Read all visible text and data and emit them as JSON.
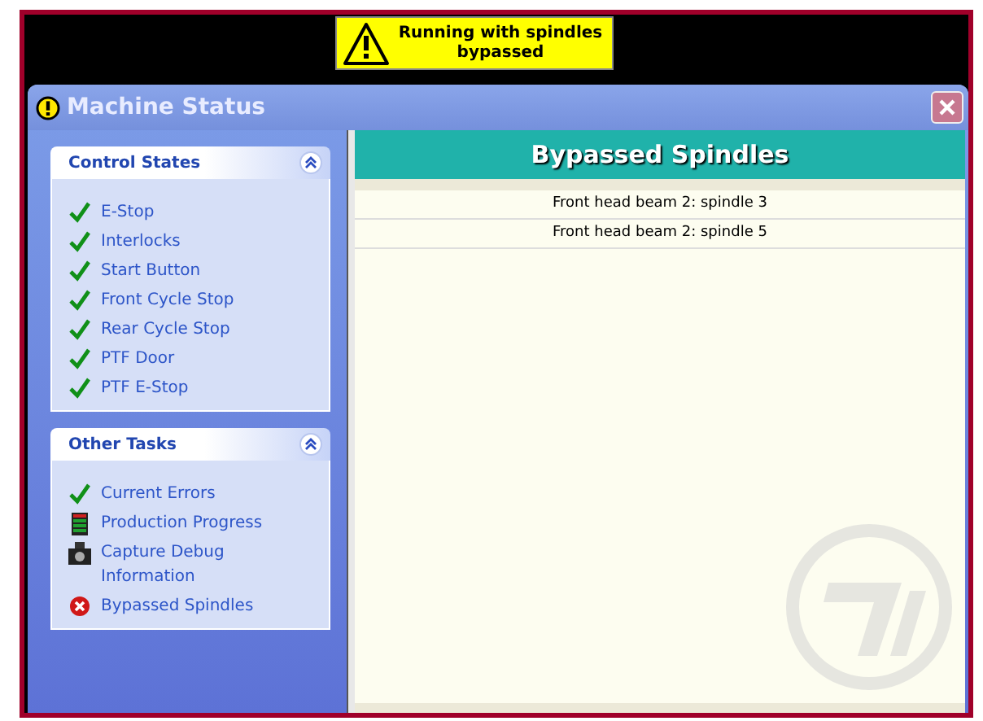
{
  "banner": {
    "text": "Running with spindles bypassed"
  },
  "window": {
    "title": "Machine Status"
  },
  "sidebar": {
    "sections": [
      {
        "title": "Control States",
        "expanded": true,
        "items": [
          {
            "label": "E-Stop",
            "kind": "check"
          },
          {
            "label": "Interlocks",
            "kind": "check"
          },
          {
            "label": "Start Button",
            "kind": "check"
          },
          {
            "label": "Front Cycle Stop",
            "kind": "check"
          },
          {
            "label": "Rear Cycle Stop",
            "kind": "check"
          },
          {
            "label": "PTF Door",
            "kind": "check"
          },
          {
            "label": "PTF E-Stop",
            "kind": "check"
          }
        ]
      },
      {
        "title": "Other Tasks",
        "expanded": true,
        "items": [
          {
            "label": "Current Errors",
            "kind": "check"
          },
          {
            "label": "Production Progress",
            "kind": "progress"
          },
          {
            "label": "Capture Debug Information",
            "kind": "camera"
          },
          {
            "label": "Bypassed Spindles",
            "kind": "error"
          }
        ]
      }
    ]
  },
  "panel": {
    "title": "Bypassed Spindles",
    "rows": [
      "Front head beam 2: spindle 3",
      "Front head beam 2: spindle 5"
    ]
  }
}
